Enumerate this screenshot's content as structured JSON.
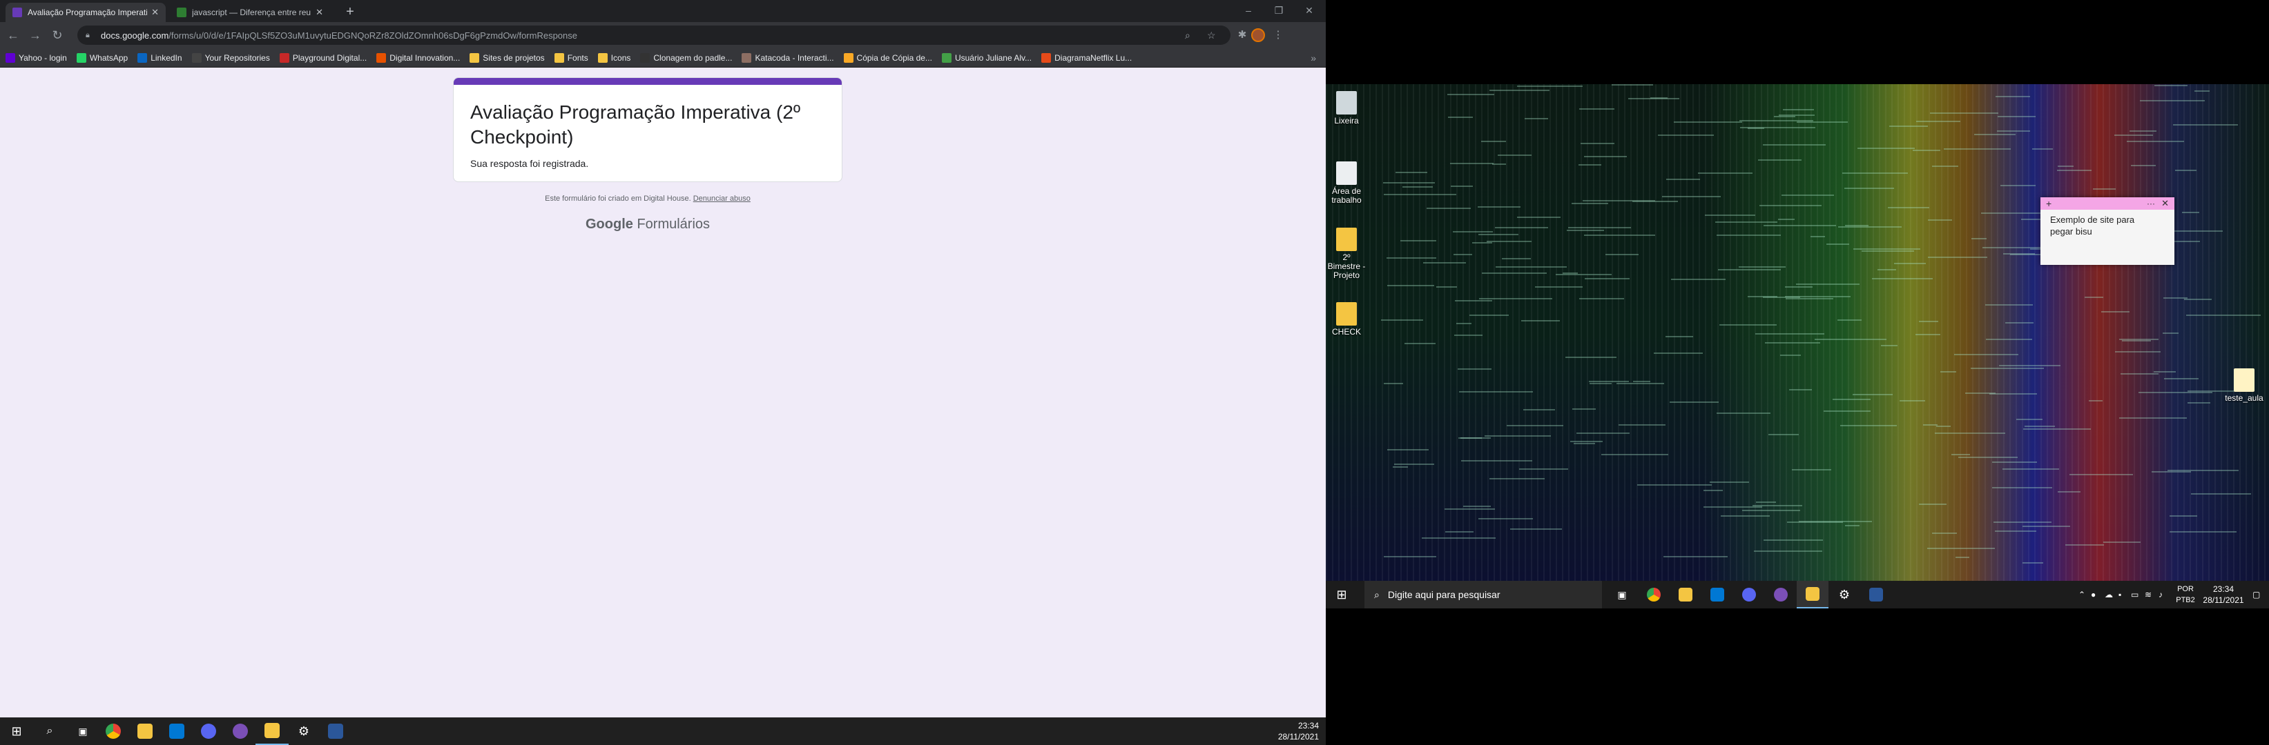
{
  "browser": {
    "tabs": [
      {
        "title": "Avaliação Programação Imperati",
        "active": true,
        "color": "#673ab7"
      },
      {
        "title": "javascript — Diferença entre reu",
        "active": false,
        "color": "#2e7d32"
      }
    ],
    "new_tab": "+",
    "window_controls": {
      "minimize": "–",
      "maximize": "❐",
      "close": "✕"
    },
    "url_host": "docs.google.com",
    "url_path": "/forms/u/0/d/e/1FAIpQLSf5ZO3uM1uvytuEDGNQoRZr8ZOldZOmnh06sDgF6gPzmdOw/formResponse",
    "bookmarks": [
      {
        "label": "Yahoo - login",
        "icon": "yahoo-icon",
        "color": "#6001d2"
      },
      {
        "label": "WhatsApp",
        "icon": "whatsapp-icon",
        "color": "#25d366"
      },
      {
        "label": "LinkedIn",
        "icon": "linkedin-icon",
        "color": "#0a66c2"
      },
      {
        "label": "Your Repositories",
        "icon": "github-icon",
        "color": "#444"
      },
      {
        "label": "Playground Digital...",
        "icon": "playground-icon",
        "color": "#c62828"
      },
      {
        "label": "Digital Innovation...",
        "icon": "dio-icon",
        "color": "#e65100"
      },
      {
        "label": "Sites de projetos",
        "icon": "folder-icon",
        "color": "#f4c542"
      },
      {
        "label": "Fonts",
        "icon": "folder-icon",
        "color": "#f4c542"
      },
      {
        "label": "Icons",
        "icon": "folder-icon",
        "color": "#f4c542"
      },
      {
        "label": "Clonagem do padle...",
        "icon": "padlet-icon",
        "color": "#333"
      },
      {
        "label": "Katacoda - Interacti...",
        "icon": "katacoda-icon",
        "color": "#8d6e63"
      },
      {
        "label": "Cópia de Cópia de...",
        "icon": "drive-icon",
        "color": "#f9a825"
      },
      {
        "label": "Usuário Juliane Alv...",
        "icon": "user-icon",
        "color": "#43a047"
      },
      {
        "label": "DiagramaNetflix Lu...",
        "icon": "diagram-icon",
        "color": "#e64a19"
      }
    ],
    "bookmarks_more": "»"
  },
  "form": {
    "title": "Avaliação Programação Imperativa (2º Checkpoint)",
    "message": "Sua resposta foi registrada.",
    "footer_text": "Este formulário foi criado em Digital House.",
    "report_link": "Denunciar abuso",
    "brand_google": "Google",
    "brand_forms": "Formulários",
    "accent": "#673ab7"
  },
  "taskbar_left": {
    "apps": [
      "windows-start-icon",
      "search-icon",
      "task-view-icon",
      "chrome-icon",
      "file-explorer-icon",
      "vscode-icon",
      "discord-icon",
      "github-desktop-icon",
      "sticky-notes-icon",
      "settings-icon",
      "word-icon"
    ],
    "time": "23:34",
    "date": "28/11/2021"
  },
  "desktop": {
    "icons": [
      {
        "label": "Lixeira"
      },
      {
        "label": "Área de trabalho"
      },
      {
        "label": "2º Bimestre - Projeto"
      },
      {
        "label": "CHECK"
      },
      {
        "label": "teste_aula"
      }
    ],
    "sticky_note": {
      "text": "Exemplo de site para pegar bisu",
      "color": "#f4a6e6"
    }
  },
  "taskbar_right": {
    "search_placeholder": "Digite aqui para pesquisar",
    "lang_1": "POR",
    "lang_2": "PTB2",
    "time": "23:34",
    "date": "28/11/2021"
  }
}
